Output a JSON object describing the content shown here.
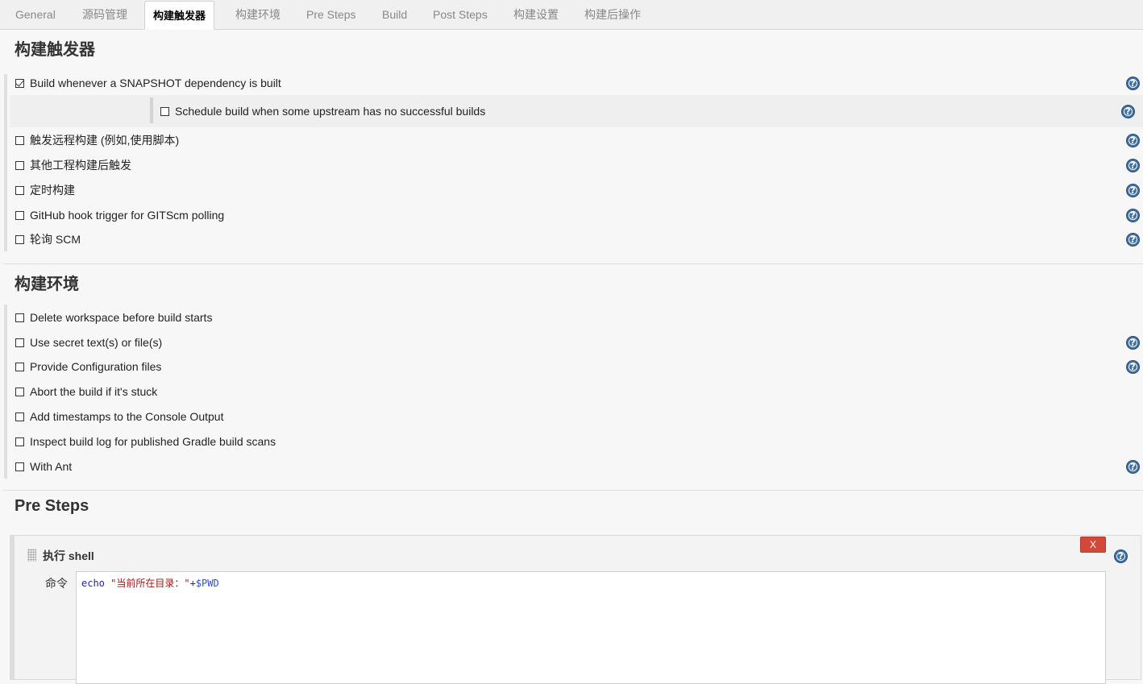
{
  "tabs": [
    {
      "label": "General",
      "active": false
    },
    {
      "label": "源码管理",
      "active": false
    },
    {
      "label": "构建触发器",
      "active": true
    },
    {
      "label": "构建环境",
      "active": false
    },
    {
      "label": "Pre Steps",
      "active": false
    },
    {
      "label": "Build",
      "active": false
    },
    {
      "label": "Post Steps",
      "active": false
    },
    {
      "label": "构建设置",
      "active": false
    },
    {
      "label": "构建后操作",
      "active": false
    }
  ],
  "triggers": {
    "title": "构建触发器",
    "snapshot_label": "Build whenever a SNAPSHOT dependency is built",
    "snapshot_checked": true,
    "upstream_label": "Schedule build when some upstream has no successful builds",
    "upstream_checked": false,
    "remote_label": "触发远程构建 (例如,使用脚本)",
    "after_other_label": "其他工程构建后触发",
    "periodic_label": "定时构建",
    "github_hook_label": "GitHub hook trigger for GITScm polling",
    "poll_scm_label": "轮询 SCM"
  },
  "environment": {
    "title": "构建环境",
    "delete_ws_label": "Delete workspace before build starts",
    "secret_label": "Use secret text(s) or file(s)",
    "config_files_label": "Provide Configuration files",
    "abort_stuck_label": "Abort the build if it's stuck",
    "timestamps_label": "Add timestamps to the Console Output",
    "gradle_label": "Inspect build log for published Gradle build scans",
    "ant_label": "With Ant"
  },
  "pre_steps": {
    "title": "Pre Steps",
    "step_title": "执行 shell",
    "delete_label": "X",
    "command_label": "命令",
    "command_keyword": "echo",
    "command_string": "\"当前所在目录：\"",
    "command_plus": "+",
    "command_var": "$PWD"
  },
  "icons": {
    "help": "help-icon",
    "drag": "drag-handle-icon"
  },
  "colors": {
    "help_blue": "#3e6fa5",
    "delete_red": "#d24939"
  }
}
